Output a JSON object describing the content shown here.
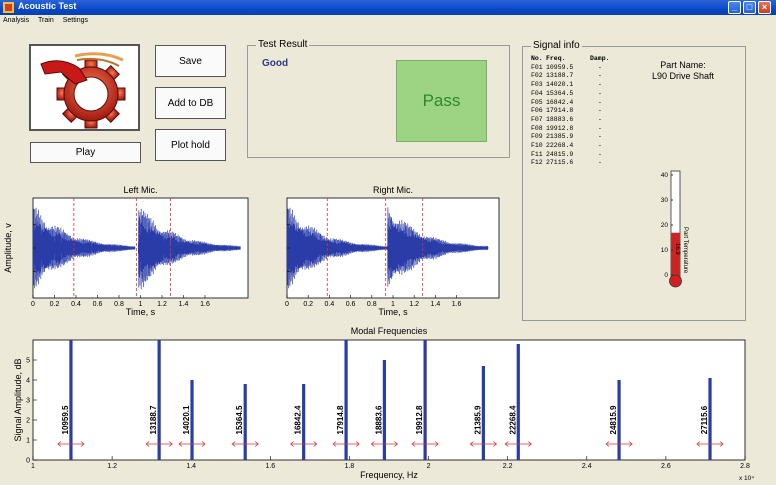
{
  "window": {
    "title": "Acoustic Test"
  },
  "menu": [
    {
      "label": "Analysis"
    },
    {
      "label": "Train"
    },
    {
      "label": "Settings"
    }
  ],
  "buttons": {
    "play": "Play",
    "save": "Save",
    "add_to_db": "Add to DB",
    "plot_hold": "Plot hold"
  },
  "test_result": {
    "legend": "Test Result",
    "status": "Good",
    "verdict": "Pass",
    "verdict_color": "#9dd484"
  },
  "signal_info": {
    "legend": "Signal info",
    "headers": {
      "no": "No.",
      "freq": "Freq.",
      "damp": "Damp."
    },
    "rows": [
      {
        "no": "F01",
        "freq": "10959.5",
        "damp": "-"
      },
      {
        "no": "F02",
        "freq": "13188.7",
        "damp": "-"
      },
      {
        "no": "F03",
        "freq": "14020.1",
        "damp": "-"
      },
      {
        "no": "F04",
        "freq": "15364.5",
        "damp": "-"
      },
      {
        "no": "F05",
        "freq": "16842.4",
        "damp": "-"
      },
      {
        "no": "F06",
        "freq": "17914.8",
        "damp": "-"
      },
      {
        "no": "F07",
        "freq": "18883.6",
        "damp": "-"
      },
      {
        "no": "F08",
        "freq": "19912.8",
        "damp": "-"
      },
      {
        "no": "F09",
        "freq": "21385.9",
        "damp": "-"
      },
      {
        "no": "F10",
        "freq": "22268.4",
        "damp": "-"
      },
      {
        "no": "F11",
        "freq": "24815.9",
        "damp": "-"
      },
      {
        "no": "F12",
        "freq": "27115.6",
        "damp": "-"
      }
    ],
    "part_name_label": "Part Name:",
    "part_name": "L90 Drive Shaft"
  },
  "thermometer": {
    "ticks": [
      "40",
      "30",
      "20",
      "10",
      "0"
    ],
    "max": 40,
    "value": 16.9,
    "value_label": "16.9",
    "label": "Part Temperature",
    "color": "#d42020"
  },
  "colors": {
    "signal": "#2a3ca8",
    "marker": "#e03030"
  },
  "chart_data": [
    {
      "type": "line",
      "title": "Left Mic.",
      "xlabel": "Time, s",
      "ylabel": "Amplitude, v",
      "xlim": [
        0,
        2
      ],
      "ylim": [
        -1,
        1
      ],
      "x_ticks": [
        "0",
        "0.2",
        "0.4",
        "0.6",
        "0.8",
        "1",
        "1.2",
        "1.4",
        "1.6"
      ],
      "impulse_times": [
        0,
        0.98
      ],
      "marker_times": [
        0.38,
        1.28
      ]
    },
    {
      "type": "line",
      "title": "Right Mic.",
      "xlabel": "Time, s",
      "ylabel": "",
      "xlim": [
        0,
        2
      ],
      "ylim": [
        -1,
        1
      ],
      "x_ticks": [
        "0",
        "0.2",
        "0.4",
        "0.6",
        "0.8",
        "1",
        "1.2",
        "1.4",
        "1.6"
      ],
      "impulse_times": [
        0,
        0.95
      ],
      "marker_times": [
        0.38,
        1.28
      ]
    },
    {
      "type": "bar",
      "title": "Modal Frequencies",
      "xlabel": "Frequency, Hz",
      "ylabel": "Signal Amplitude, dB",
      "x_multiplier": "x 10⁴",
      "xlim": [
        1,
        2.8
      ],
      "ylim": [
        0,
        6
      ],
      "x_ticks": [
        "1",
        "1.2",
        "1.4",
        "1.6",
        "1.8",
        "2",
        "2.2",
        "2.4",
        "2.6",
        "2.8"
      ],
      "y_ticks": [
        "0",
        "1",
        "2",
        "3",
        "4",
        "5"
      ],
      "series": [
        {
          "values": [
            {
              "x": 1.09595,
              "y": 6.0,
              "label": "10959.5"
            },
            {
              "x": 1.31887,
              "y": 6.0,
              "label": "13188.7"
            },
            {
              "x": 1.40201,
              "y": 4.0,
              "label": "14020.1"
            },
            {
              "x": 1.53645,
              "y": 3.8,
              "label": "15364.5"
            },
            {
              "x": 1.68424,
              "y": 3.8,
              "label": "16842.4"
            },
            {
              "x": 1.79148,
              "y": 6.0,
              "label": "17914.8"
            },
            {
              "x": 1.88836,
              "y": 5.0,
              "label": "18883.6"
            },
            {
              "x": 1.99128,
              "y": 6.0,
              "label": "19912.8"
            },
            {
              "x": 2.13859,
              "y": 4.7,
              "label": "21385.9"
            },
            {
              "x": 2.22684,
              "y": 5.8,
              "label": "22268.4"
            },
            {
              "x": 2.48159,
              "y": 4.0,
              "label": "24815.9"
            },
            {
              "x": 2.71156,
              "y": 4.1,
              "label": "27115.6"
            }
          ]
        }
      ]
    }
  ]
}
